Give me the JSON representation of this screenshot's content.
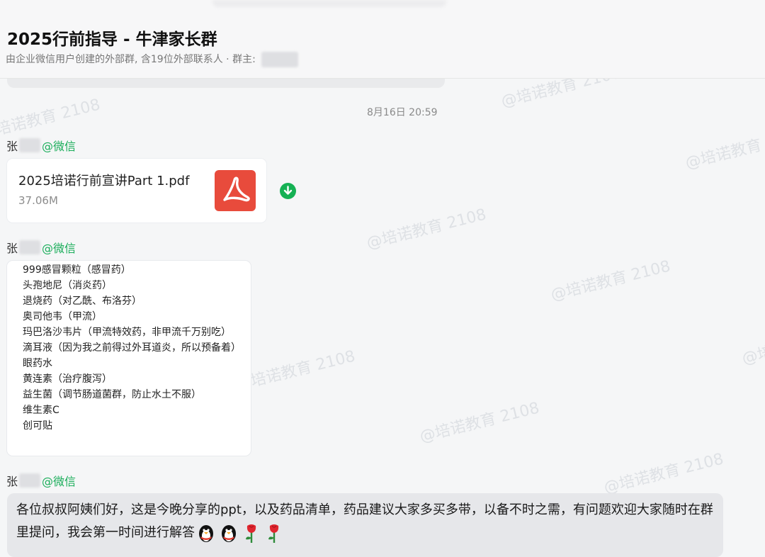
{
  "header": {
    "title": "2025行前指导 - 牛津家长群",
    "subtitle": "由企业微信用户创建的外部群, 含19位外部联系人 · 群主:"
  },
  "watermark_text": "@培诺教育 2108",
  "timestamp": "8月16日 20:59",
  "messages": [
    {
      "sender": {
        "surname": "张",
        "suffix": "@微信"
      },
      "file": {
        "name": "2025培诺行前宣讲Part 1.pdf",
        "size": "37.06M",
        "icon": "pdf-icon"
      }
    },
    {
      "sender": {
        "surname": "张",
        "suffix": "@微信"
      },
      "list": [
        "999感冒颗粒（感冒药）",
        "头孢地尼（消炎药）",
        "退烧药（对乙酰、布洛芬）",
        "奥司他韦（甲流）",
        "玛巴洛沙韦片（甲流特效药，非甲流千万别吃）",
        "滴耳液（因为我之前得过外耳道炎，所以预备着）",
        "眼药水",
        "黄连素（治疗腹泻）",
        "益生菌（调节肠道菌群，防止水土不服）",
        "维生素C",
        "创可贴"
      ]
    },
    {
      "sender": {
        "surname": "张",
        "suffix": "@微信"
      },
      "text": "各位叔叔阿姨们好，这是今晚分享的ppt，以及药品清单，药品建议大家多买多带，以备不时之需，有问题欢迎大家随时在群里提问，我会第一时间进行解答",
      "emojis": [
        "penguin-icon",
        "penguin-icon",
        "rose-icon",
        "rose-icon"
      ]
    }
  ],
  "colors": {
    "wechat_green": "#1aad5a",
    "pdf_red": "#e84b3c",
    "download_green": "#15b154"
  }
}
